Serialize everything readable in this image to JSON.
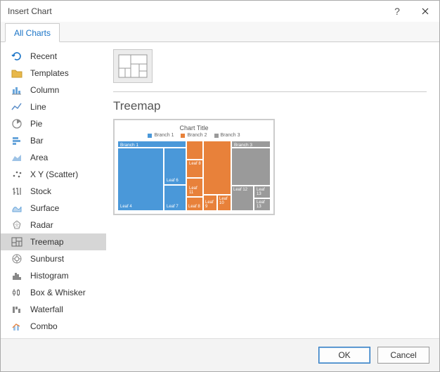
{
  "dialog": {
    "title": "Insert Chart"
  },
  "tabs": {
    "all_charts": "All Charts"
  },
  "sidebar": {
    "items": [
      {
        "label": "Recent"
      },
      {
        "label": "Templates"
      },
      {
        "label": "Column"
      },
      {
        "label": "Line"
      },
      {
        "label": "Pie"
      },
      {
        "label": "Bar"
      },
      {
        "label": "Area"
      },
      {
        "label": "X Y (Scatter)"
      },
      {
        "label": "Stock"
      },
      {
        "label": "Surface"
      },
      {
        "label": "Radar"
      },
      {
        "label": "Treemap"
      },
      {
        "label": "Sunburst"
      },
      {
        "label": "Histogram"
      },
      {
        "label": "Box & Whisker"
      },
      {
        "label": "Waterfall"
      },
      {
        "label": "Combo"
      }
    ],
    "selected_index": 11
  },
  "main": {
    "subtype_title": "Treemap",
    "preview": {
      "title": "Chart Title",
      "legend": [
        "Branch 1",
        "Branch 2",
        "Branch 3"
      ],
      "colors": {
        "branch1": "#4a98d9",
        "branch2": "#e8813a",
        "branch3": "#9a9a9a"
      },
      "cells": {
        "branch1_header": "Branch 1",
        "leaf6": "Leaf 6",
        "leaf7": "Leaf 7",
        "leaf4": "Leaf 4",
        "branch2_a": "",
        "leaf8": "Leaf 8",
        "leaf11": "Leaf 11",
        "leaf9": "Leaf 9",
        "leaf10": "Leaf 10",
        "branch3_header": "Branch 3",
        "leaf12": "Leaf 12",
        "leaf13": "Leaf 13"
      }
    }
  },
  "footer": {
    "ok": "OK",
    "cancel": "Cancel"
  },
  "chart_data": {
    "type": "treemap",
    "title": "Chart Title",
    "series": [
      {
        "name": "Branch 1",
        "color": "#4a98d9",
        "children": [
          {
            "name": "Leaf 4",
            "value": 28
          },
          {
            "name": "Leaf 6",
            "value": 10
          },
          {
            "name": "Leaf 7",
            "value": 8
          },
          {
            "name": "(unlabeled)",
            "value": 4
          }
        ]
      },
      {
        "name": "Branch 2",
        "color": "#e8813a",
        "children": [
          {
            "name": "Leaf 8",
            "value": 10
          },
          {
            "name": "Leaf 9",
            "value": 5
          },
          {
            "name": "Leaf 10",
            "value": 5
          },
          {
            "name": "Leaf 11",
            "value": 10
          }
        ]
      },
      {
        "name": "Branch 3",
        "color": "#9a9a9a",
        "children": [
          {
            "name": "Leaf 12",
            "value": 6
          },
          {
            "name": "Leaf 13",
            "value": 6
          },
          {
            "name": "(unlabeled)",
            "value": 8
          }
        ]
      }
    ]
  }
}
